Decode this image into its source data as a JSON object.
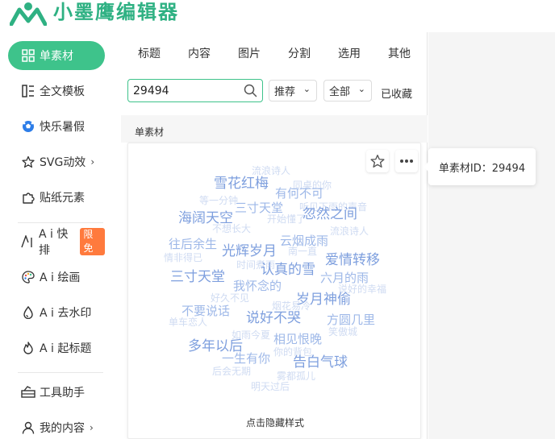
{
  "app": {
    "name": "小墨鹰编辑器"
  },
  "sidebar": {
    "items": [
      {
        "label": "单素材",
        "icon": "grid-icon"
      },
      {
        "label": "全文模板",
        "icon": "layout-icon"
      },
      {
        "label": "快乐暑假",
        "icon": "soccer-ball-icon"
      },
      {
        "label": "SVG动效",
        "icon": "star-outline-icon"
      },
      {
        "label": "贴纸元素",
        "icon": "puzzle-icon"
      },
      {
        "label": "A i 快排",
        "icon": "ai-icon",
        "badge": "限免"
      },
      {
        "label": "A i 绘画",
        "icon": "palette-icon"
      },
      {
        "label": "A i 去水印",
        "icon": "drop-icon"
      },
      {
        "label": "A i 起标题",
        "icon": "flame-icon"
      },
      {
        "label": "工具助手",
        "icon": "toolbox-icon"
      },
      {
        "label": "我的内容",
        "icon": "user-icon"
      }
    ]
  },
  "tabs": [
    "标题",
    "内容",
    "图片",
    "分割",
    "选用",
    "其他"
  ],
  "search": {
    "value": "29494"
  },
  "filters": {
    "sort": "推荐",
    "scope": "全部",
    "collected": "已收藏"
  },
  "section": {
    "title": "单素材"
  },
  "card": {
    "hide_label": "点击隐藏样式",
    "tooltip": "单素材ID：29494",
    "words": [
      "流浪诗人",
      "雪花红梅",
      "同桌的你",
      "有何不可",
      "等一分钟",
      "三寸天堂",
      "听见下雨的声音",
      "海阔天空",
      "开始懂了",
      "忽然之间",
      "不想长大",
      "流浪诗人",
      "往后余生",
      "云烟成雨",
      "情非得已",
      "光辉岁月",
      "南一直",
      "爱情转移",
      "时间煮雨",
      "认真的雪",
      "三寸天堂",
      "六月的雨",
      "我怀念的",
      "好久不见",
      "说好的幸福",
      "岁月神偷",
      "不要说话",
      "烟花易冷",
      "单车恋人",
      "说好不哭",
      "方圆几里",
      "如雨今夏",
      "相见恨晚",
      "笑傲城",
      "多年以后",
      "你的背包",
      "一生有你",
      "告白气球",
      "后会无期",
      "雾都孤儿",
      "明天过后"
    ]
  },
  "colors": {
    "accent": "#3ec38b",
    "brand": "#2fb183",
    "badge": "#ff7a3d",
    "cloud_light": "#cfdbf2",
    "cloud_mid": "#9eb8e8",
    "cloud_dark": "#7e9fde"
  }
}
